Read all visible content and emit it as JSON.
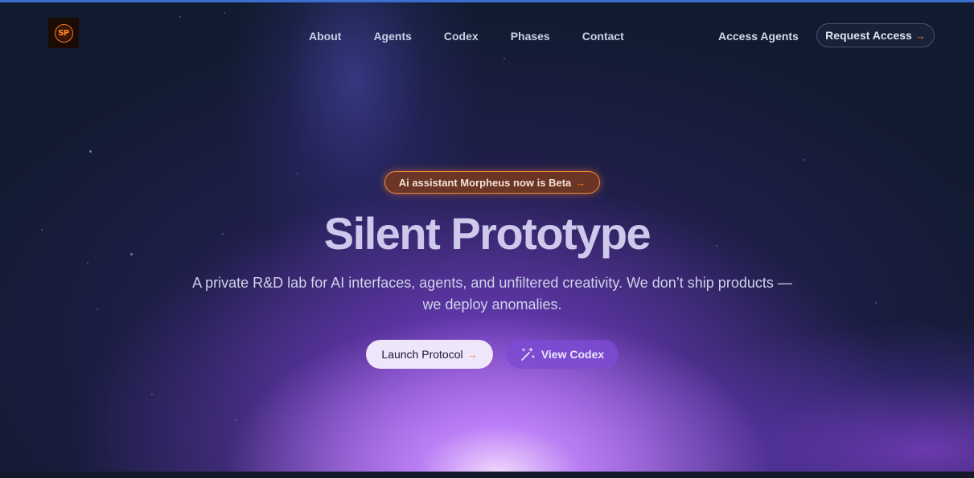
{
  "header": {
    "logo_text": "SP",
    "nav": [
      {
        "label": "About"
      },
      {
        "label": "Agents"
      },
      {
        "label": "Codex"
      },
      {
        "label": "Phases"
      },
      {
        "label": "Contact"
      }
    ],
    "access_agents_label": "Access Agents",
    "request_access_label": "Request Access",
    "request_access_icon": "arrow-right-icon"
  },
  "hero": {
    "badge_text": "Ai assistant Morpheus now is Beta",
    "badge_icon": "arrow-right-icon",
    "title": "Silent Prototype",
    "subtitle": "A private R&D lab for AI interfaces, agents, and unfiltered creativity. We don’t ship products — we deploy anomalies.",
    "launch_label": "Launch Protocol",
    "launch_icon": "arrow-right-icon",
    "codex_label": "View Codex",
    "codex_icon": "magic-wand-icon"
  },
  "colors": {
    "background": "#111a2e",
    "accent_orange": "#ff7a1f",
    "accent_purple": "#a855f7",
    "title_color": "#cdc8ec"
  }
}
